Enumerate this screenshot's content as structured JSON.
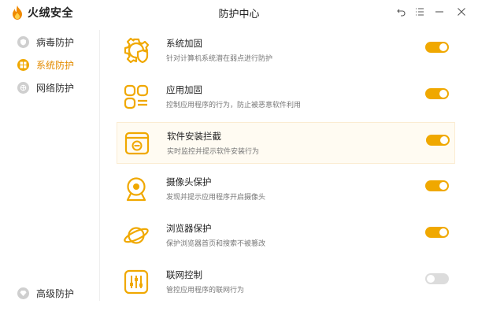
{
  "app": {
    "logo_text": "火绒安全",
    "window_title": "防护中心"
  },
  "colors": {
    "accent": "#f0a800",
    "active_text": "#e38b00",
    "toggle_off": "#dcdcdc"
  },
  "sidebar": {
    "items": [
      {
        "label": "病毒防护",
        "icon": "virus-shield-icon",
        "active": false
      },
      {
        "label": "系统防护",
        "icon": "windows-icon",
        "active": true
      },
      {
        "label": "网络防护",
        "icon": "network-icon",
        "active": false
      }
    ],
    "bottom_item": {
      "label": "高级防护",
      "icon": "diamond-icon"
    }
  },
  "protections": [
    {
      "title": "系统加固",
      "desc": "针对计算机系统潜在弱点进行防护",
      "icon": "gear-shield-icon",
      "enabled": true
    },
    {
      "title": "应用加固",
      "desc": "控制应用程序的行为，防止被恶意软件利用",
      "icon": "app-grid-icon",
      "enabled": true
    },
    {
      "title": "软件安装拦截",
      "desc": "实时监控并提示软件安装行为",
      "icon": "install-block-icon",
      "enabled": true
    },
    {
      "title": "摄像头保护",
      "desc": "发现并提示应用程序开启摄像头",
      "icon": "camera-icon",
      "enabled": true
    },
    {
      "title": "浏览器保护",
      "desc": "保护浏览器首页和搜索不被篡改",
      "icon": "planet-icon",
      "enabled": true
    },
    {
      "title": "联网控制",
      "desc": "管控应用程序的联网行为",
      "icon": "sliders-icon",
      "enabled": false
    }
  ]
}
